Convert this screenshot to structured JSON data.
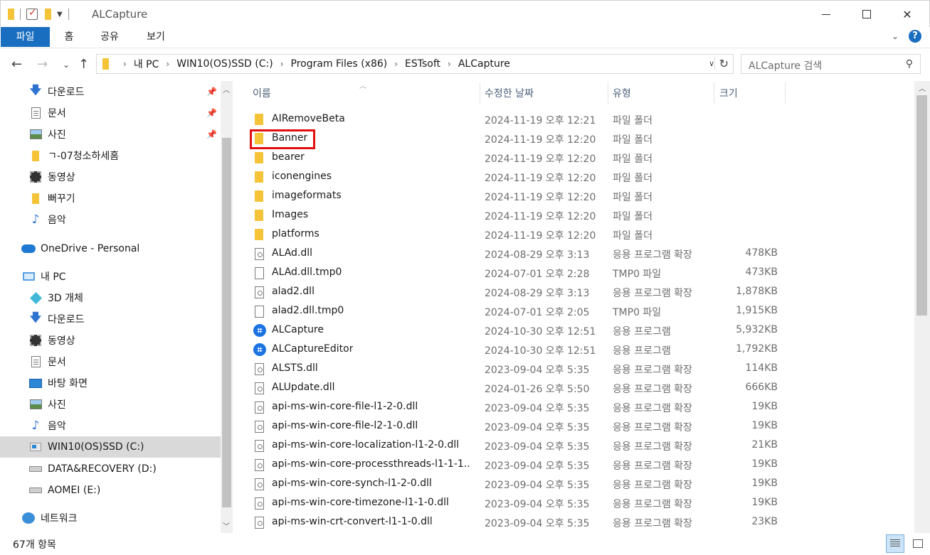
{
  "window": {
    "title": "ALCapture",
    "controls": {
      "minimize": "minimize",
      "maximize": "maximize",
      "close": "close"
    }
  },
  "ribbon": {
    "tabs": [
      {
        "label": "파일",
        "active": true
      },
      {
        "label": "홈"
      },
      {
        "label": "공유"
      },
      {
        "label": "보기"
      }
    ]
  },
  "address": {
    "crumbs": [
      "내 PC",
      "WIN10(OS)SSD (C:)",
      "Program Files (x86)",
      "ESTsoft",
      "ALCapture"
    ]
  },
  "search": {
    "placeholder": "ALCapture 검색"
  },
  "nav": {
    "items": [
      {
        "label": "다운로드",
        "icon": "download-icon",
        "pinned": true
      },
      {
        "label": "문서",
        "icon": "document-icon",
        "pinned": true
      },
      {
        "label": "사진",
        "icon": "picture-icon",
        "pinned": true
      },
      {
        "label": "ㄱ-07청소하세홈",
        "icon": "folder-icon"
      },
      {
        "label": "동영상",
        "icon": "video-icon"
      },
      {
        "label": "뻐꾸기",
        "icon": "folder-icon"
      },
      {
        "label": "음악",
        "icon": "music-icon"
      },
      {
        "label": "OneDrive - Personal",
        "icon": "cloud-icon"
      },
      {
        "label": "내 PC",
        "icon": "pc-icon"
      },
      {
        "label": "3D 개체",
        "icon": "3d-objects-icon"
      },
      {
        "label": "다운로드",
        "icon": "download-icon"
      },
      {
        "label": "동영상",
        "icon": "video-icon"
      },
      {
        "label": "문서",
        "icon": "document-icon"
      },
      {
        "label": "바탕 화면",
        "icon": "desktop-icon"
      },
      {
        "label": "사진",
        "icon": "picture-icon"
      },
      {
        "label": "음악",
        "icon": "music-icon"
      },
      {
        "label": "WIN10(OS)SSD (C:)",
        "icon": "windows-drive-icon",
        "selected": true
      },
      {
        "label": "DATA&RECOVERY (D:)",
        "icon": "drive-icon"
      },
      {
        "label": "AOMEI (E:)",
        "icon": "drive-icon"
      },
      {
        "label": "네트워크",
        "icon": "network-icon"
      }
    ]
  },
  "columns": {
    "name": "이름",
    "date": "수정한 날짜",
    "type": "유형",
    "size": "크기"
  },
  "files": [
    {
      "name": "AIRemoveBeta",
      "date": "2024-11-19 오후 12:21",
      "type": "파일 폴더",
      "size": "",
      "kind": "folder"
    },
    {
      "name": "Banner",
      "date": "2024-11-19 오후 12:20",
      "type": "파일 폴더",
      "size": "",
      "kind": "folder",
      "highlighted": true
    },
    {
      "name": "bearer",
      "date": "2024-11-19 오후 12:20",
      "type": "파일 폴더",
      "size": "",
      "kind": "folder"
    },
    {
      "name": "iconengines",
      "date": "2024-11-19 오후 12:20",
      "type": "파일 폴더",
      "size": "",
      "kind": "folder"
    },
    {
      "name": "imageformats",
      "date": "2024-11-19 오후 12:20",
      "type": "파일 폴더",
      "size": "",
      "kind": "folder"
    },
    {
      "name": "Images",
      "date": "2024-11-19 오후 12:20",
      "type": "파일 폴더",
      "size": "",
      "kind": "folder"
    },
    {
      "name": "platforms",
      "date": "2024-11-19 오후 12:20",
      "type": "파일 폴더",
      "size": "",
      "kind": "folder"
    },
    {
      "name": "ALAd.dll",
      "date": "2024-08-29 오후 3:13",
      "type": "응용 프로그램 확장",
      "size": "478KB",
      "kind": "dll"
    },
    {
      "name": "ALAd.dll.tmp0",
      "date": "2024-07-01 오후 2:28",
      "type": "TMP0 파일",
      "size": "473KB",
      "kind": "file"
    },
    {
      "name": "alad2.dll",
      "date": "2024-08-29 오후 3:13",
      "type": "응용 프로그램 확장",
      "size": "1,878KB",
      "kind": "dll"
    },
    {
      "name": "alad2.dll.tmp0",
      "date": "2024-07-01 오후 2:05",
      "type": "TMP0 파일",
      "size": "1,915KB",
      "kind": "file"
    },
    {
      "name": "ALCapture",
      "date": "2024-10-30 오후 12:51",
      "type": "응용 프로그램",
      "size": "5,932KB",
      "kind": "app"
    },
    {
      "name": "ALCaptureEditor",
      "date": "2024-10-30 오후 12:51",
      "type": "응용 프로그램",
      "size": "1,792KB",
      "kind": "app"
    },
    {
      "name": "ALSTS.dll",
      "date": "2023-09-04 오후 5:35",
      "type": "응용 프로그램 확장",
      "size": "114KB",
      "kind": "dll"
    },
    {
      "name": "ALUpdate.dll",
      "date": "2024-01-26 오후 5:50",
      "type": "응용 프로그램 확장",
      "size": "666KB",
      "kind": "dll"
    },
    {
      "name": "api-ms-win-core-file-l1-2-0.dll",
      "date": "2023-09-04 오후 5:35",
      "type": "응용 프로그램 확장",
      "size": "19KB",
      "kind": "dll"
    },
    {
      "name": "api-ms-win-core-file-l2-1-0.dll",
      "date": "2023-09-04 오후 5:35",
      "type": "응용 프로그램 확장",
      "size": "19KB",
      "kind": "dll"
    },
    {
      "name": "api-ms-win-core-localization-l1-2-0.dll",
      "date": "2023-09-04 오후 5:35",
      "type": "응용 프로그램 확장",
      "size": "21KB",
      "kind": "dll"
    },
    {
      "name": "api-ms-win-core-processthreads-l1-1-1...",
      "date": "2023-09-04 오후 5:35",
      "type": "응용 프로그램 확장",
      "size": "19KB",
      "kind": "dll"
    },
    {
      "name": "api-ms-win-core-synch-l1-2-0.dll",
      "date": "2023-09-04 오후 5:35",
      "type": "응용 프로그램 확장",
      "size": "19KB",
      "kind": "dll"
    },
    {
      "name": "api-ms-win-core-timezone-l1-1-0.dll",
      "date": "2023-09-04 오후 5:35",
      "type": "응용 프로그램 확장",
      "size": "19KB",
      "kind": "dll"
    },
    {
      "name": "api-ms-win-crt-convert-l1-1-0.dll",
      "date": "2023-09-04 오후 5:35",
      "type": "응용 프로그램 확장",
      "size": "23KB",
      "kind": "dll"
    }
  ],
  "status": {
    "item_count": "67개 항목"
  },
  "colors": {
    "accent": "#1a6ec0",
    "highlight": "#e01010",
    "folder": "#f4c338"
  }
}
